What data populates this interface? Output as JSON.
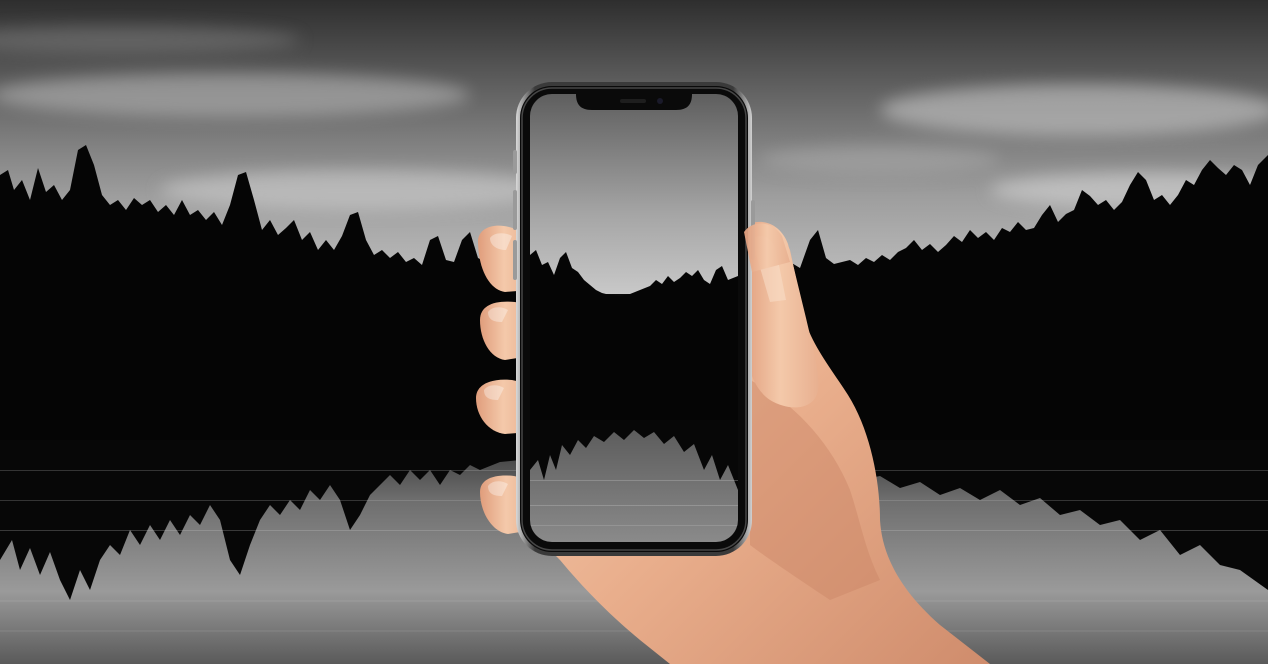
{
  "scene": {
    "palette": {
      "sky_top": "#3a3a3a",
      "sky_mid": "#8c8c8c",
      "horizon": "#bdbdbd",
      "forest": "#050505",
      "water_light": "#9a9a9a",
      "phone_frame": "#1a1a1a",
      "phone_bezel": "#0a0a0a",
      "skin_light": "#f2c8a8",
      "skin_mid": "#e6a886",
      "skin_shadow": "#c98466"
    },
    "icons": {
      "phone": "smartphone-icon",
      "hand": "hand-icon"
    }
  }
}
